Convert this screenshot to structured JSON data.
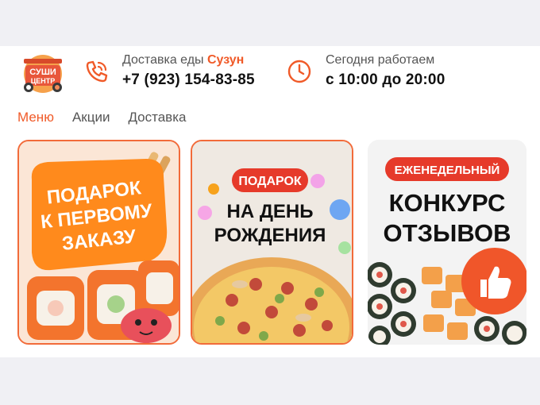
{
  "header": {
    "logo_text_line1": "СУШИ",
    "logo_text_line2": "ЦЕНТР",
    "delivery_prefix": "Доставка еды ",
    "delivery_city": "Сузун",
    "phone": "+7 (923) 154-83-85",
    "hours_label": "Сегодня работаем",
    "hours_value": "с 10:00 до 20:00",
    "icons": [
      "phone-icon",
      "clock-icon"
    ]
  },
  "nav": {
    "items": [
      "Меню",
      "Акции",
      "Доставка"
    ],
    "active": "Меню"
  },
  "promos": [
    {
      "lines": [
        "ПОДАРОК",
        "К ПЕРВОМУ",
        "ЗАКАЗУ"
      ]
    },
    {
      "badge": "ПОДАРОК",
      "lines": [
        "НА ДЕНЬ",
        "РОЖДЕНИЯ"
      ]
    },
    {
      "badge": "ЕЖЕНЕДЕЛЬНЫЙ",
      "lines": [
        "КОНКУРС",
        "ОТЗЫВОВ"
      ]
    }
  ],
  "colors": {
    "accent": "#f05a28",
    "brand_orange": "#ff8c1a",
    "badge_red": "#e63a2a"
  }
}
